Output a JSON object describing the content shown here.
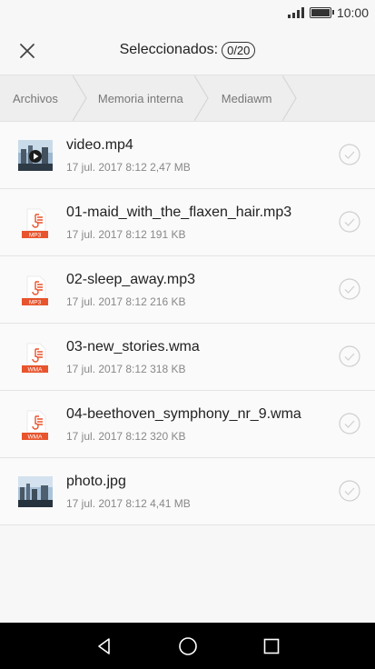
{
  "status_bar": {
    "time": "10:00"
  },
  "header": {
    "title": "Seleccionados:",
    "count": "0/20"
  },
  "breadcrumb": [
    "Archivos",
    "Memoria interna",
    "Mediawm"
  ],
  "files": [
    {
      "name": "video.mp4",
      "date": "17 jul. 2017 8:12",
      "size": "2,47 MB",
      "type": "video",
      "badge": ""
    },
    {
      "name": "01-maid_with_the_flaxen_hair.mp3",
      "date": "17 jul. 2017 8:12",
      "size": "191 KB",
      "type": "audio",
      "badge": "MP3"
    },
    {
      "name": "02-sleep_away.mp3",
      "date": "17 jul. 2017 8:12",
      "size": "216 KB",
      "type": "audio",
      "badge": "MP3"
    },
    {
      "name": "03-new_stories.wma",
      "date": "17 jul. 2017 8:12",
      "size": "318 KB",
      "type": "audio",
      "badge": "WMA"
    },
    {
      "name": "04-beethoven_symphony_nr_9.wma",
      "date": "17 jul. 2017 8:12",
      "size": "320 KB",
      "type": "audio",
      "badge": "WMA"
    },
    {
      "name": "photo.jpg",
      "date": "17 jul. 2017 8:12",
      "size": "4,41 MB",
      "type": "image",
      "badge": ""
    }
  ],
  "colors": {
    "accent": "#e8542d",
    "nav": "#000000"
  }
}
